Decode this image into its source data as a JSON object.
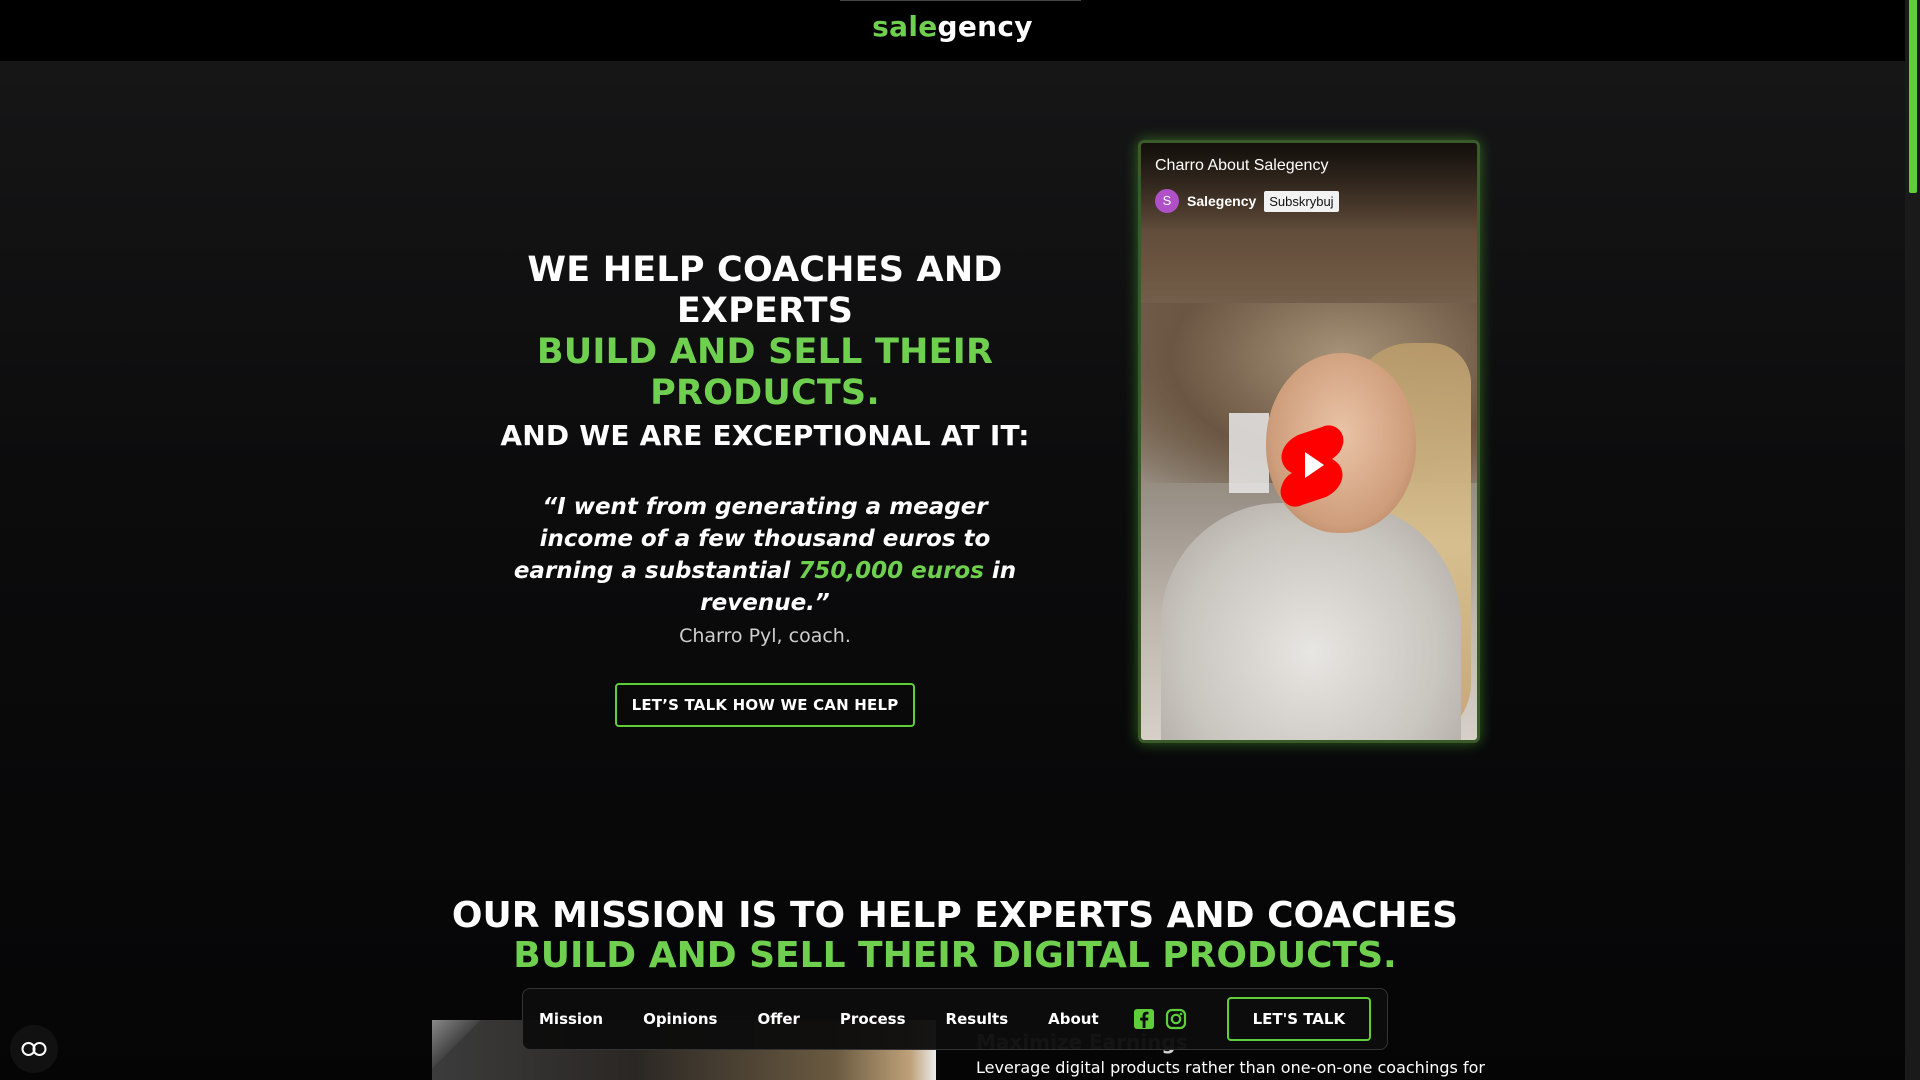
{
  "header": {
    "logo_part1": "sale",
    "logo_part2": "gency"
  },
  "hero": {
    "headline_line1": "WE HELP COACHES AND EXPERTS",
    "headline_line2": "BUILD AND SELL THEIR PRODUCTS.",
    "headline_line3": "AND WE ARE EXCEPTIONAL AT IT:",
    "quote_part1": "“I went from generating a meager income of a few thousand euros to earning a substantial ",
    "quote_highlight": "750,000 euros",
    "quote_part2": " in revenue.”",
    "author": "Charro Pyl, coach.",
    "cta_label": "LET’S TALK HOW WE CAN HELP"
  },
  "video": {
    "title": "Charro About Salegency",
    "channel_initial": "S",
    "channel_name": "Salegency",
    "subscribe_label": "Subskrybuj",
    "play_icon": "youtube-play-icon"
  },
  "mission": {
    "line1": "OUR MISSION IS TO HELP EXPERTS AND COACHES",
    "line2": "BUILD AND SELL THEIR DIGITAL PRODUCTS."
  },
  "section": {
    "heading": "Maximize Earnings",
    "text": "Leverage digital products rather than one-on-one coachings for"
  },
  "nav": {
    "items": [
      "Mission",
      "Opinions",
      "Offer",
      "Process",
      "Results",
      "About"
    ],
    "cta_label": "LET'S TALK",
    "icons": [
      "facebook-icon",
      "instagram-icon"
    ]
  },
  "colors": {
    "accent": "#6fcf4e",
    "background": "#0a0a0b",
    "header_bg": "#000000"
  }
}
